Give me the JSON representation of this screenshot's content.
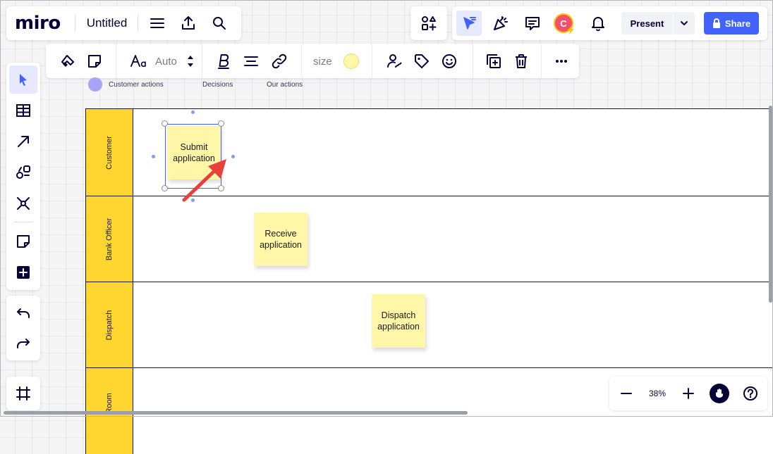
{
  "app": {
    "logo": "miro",
    "board_title": "Untitled"
  },
  "top_right": {
    "present_label": "Present",
    "share_label": "Share",
    "avatar_initial": "C",
    "accent_color": "#4262ff",
    "avatar_color": "#f24f6d"
  },
  "context_toolbar": {
    "font_size_value": "Auto",
    "size_label": "size",
    "sticky_color": "#fff6a8"
  },
  "legend": [
    {
      "label": "Customer actions",
      "color": "#a9a3f5"
    },
    {
      "label": "Decisions"
    },
    {
      "label": "Our actions"
    }
  ],
  "swimlanes": [
    {
      "label": "Customer"
    },
    {
      "label": "Bank Officer"
    },
    {
      "label": "Dispatch"
    },
    {
      "label": "Room"
    }
  ],
  "stickies": [
    {
      "text": "Submit application",
      "selected": true
    },
    {
      "text": "Receive application"
    },
    {
      "text": "Dispatch application"
    }
  ],
  "zoom": {
    "value": "38%"
  },
  "icons": {
    "top_left": [
      "menu-icon",
      "export-icon",
      "search-icon"
    ],
    "top_right": [
      "apps-icon",
      "cursor-filter-icon",
      "celebrate-icon",
      "comments-icon",
      "avatar",
      "notifications-icon",
      "chevron-down-icon",
      "lock-icon"
    ],
    "left_toolbar": [
      "select-icon",
      "table-icon",
      "arrow-icon",
      "shapes-icon",
      "mindmap-icon",
      "sticky-note-icon",
      "add-icon",
      "undo-icon",
      "redo-icon",
      "frames-icon"
    ],
    "context_toolbar": [
      "jira-icon",
      "sticky-shape-icon",
      "font-icon",
      "stepper-icon",
      "bold-icon",
      "align-icon",
      "link-icon",
      "color-swatch",
      "assign-icon",
      "tag-icon",
      "emoji-icon",
      "duplicate-icon",
      "delete-icon",
      "more-icon"
    ],
    "zoom": [
      "zoom-out-icon",
      "zoom-in-icon",
      "hand-icon",
      "help-icon"
    ]
  }
}
